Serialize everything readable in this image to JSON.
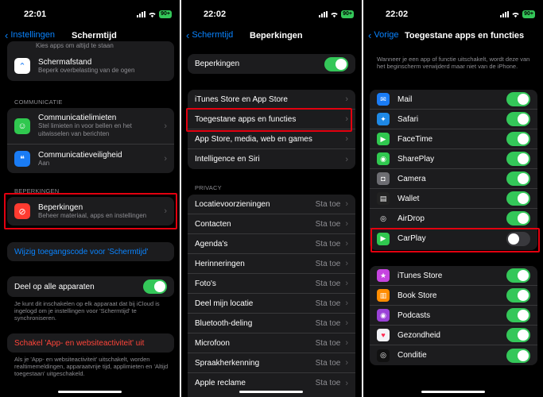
{
  "panel1": {
    "time": "22:01",
    "battery": "90+",
    "back_label": "Instellingen",
    "title": "Schermtijd",
    "top_item": {
      "partial_sub": "Kies apps om altijd te staan",
      "title": "Schermafstand",
      "sub": "Beperk overbelasting van de ogen"
    },
    "section_communicatie": "COMMUNICATIE",
    "comm_items": [
      {
        "title": "Communicatielimieten",
        "sub": "Stel limieten in voor bellen en het uitwisselen van berichten"
      },
      {
        "title": "Communicatieveiligheid",
        "sub": "Aan"
      }
    ],
    "section_beperkingen": "BEPERKINGEN",
    "beperkingen_item": {
      "title": "Beperkingen",
      "sub": "Beheer materiaal, apps en instellingen"
    },
    "passcode_link": "Wijzig toegangscode voor 'Schermtijd'",
    "share_label": "Deel op alle apparaten",
    "share_note": "Je kunt dit inschakelen op elk apparaat dat bij iCloud is ingelogd om je instellingen voor 'Schermtijd' te synchroniseren.",
    "disable_label": "Schakel 'App- en websiteactiviteit' uit",
    "disable_note": "Als je 'App- en websiteactiviteit' uitschakelt, worden realtimemeldingen, apparaatvrije tijd, applimieten en 'Altijd toegestaan' uitgeschakeld."
  },
  "panel2": {
    "time": "22:02",
    "battery": "90+",
    "back_label": "Schermtijd",
    "title": "Beperkingen",
    "toggle_label": "Beperkingen",
    "menu_items": [
      "iTunes Store en App Store",
      "Toegestane apps en functies",
      "App Store, media, web en games",
      "Intelligence en Siri"
    ],
    "privacy_header": "PRIVACY",
    "privacy_items": [
      {
        "label": "Locatievoorzieningen",
        "value": "Sta toe"
      },
      {
        "label": "Contacten",
        "value": "Sta toe"
      },
      {
        "label": "Agenda's",
        "value": "Sta toe"
      },
      {
        "label": "Herinneringen",
        "value": "Sta toe"
      },
      {
        "label": "Foto's",
        "value": "Sta toe"
      },
      {
        "label": "Deel mijn locatie",
        "value": "Sta toe"
      },
      {
        "label": "Bluetooth-deling",
        "value": "Sta toe"
      },
      {
        "label": "Microfoon",
        "value": "Sta toe"
      },
      {
        "label": "Spraakherkenning",
        "value": "Sta toe"
      },
      {
        "label": "Apple reclame",
        "value": "Sta toe"
      }
    ]
  },
  "panel3": {
    "time": "22:02",
    "battery": "90+",
    "back_label": "Vorige",
    "title": "Toegestane apps en functies",
    "note": "Wanneer je een app of functie uitschakelt, wordt deze van het beginscherm verwijderd maar niet van de iPhone.",
    "apps1": [
      {
        "label": "Mail",
        "on": true,
        "icon": "mail-icon",
        "color": "#1a7cf5",
        "glyph": "✉"
      },
      {
        "label": "Safari",
        "on": true,
        "icon": "safari-icon",
        "color": "#1e88e5",
        "glyph": "✦"
      },
      {
        "label": "FaceTime",
        "on": true,
        "icon": "facetime-icon",
        "color": "#30c84f",
        "glyph": "▶"
      },
      {
        "label": "SharePlay",
        "on": true,
        "icon": "shareplay-icon",
        "color": "#30c84f",
        "glyph": "◉"
      },
      {
        "label": "Camera",
        "on": true,
        "icon": "camera-icon",
        "color": "#6d6d72",
        "glyph": "◘"
      },
      {
        "label": "Wallet",
        "on": true,
        "icon": "wallet-icon",
        "color": "#222222",
        "glyph": "▤"
      },
      {
        "label": "AirDrop",
        "on": true,
        "icon": "airdrop-icon",
        "color": "#1c1c1e",
        "glyph": "◎"
      },
      {
        "label": "CarPlay",
        "on": false,
        "icon": "carplay-icon",
        "color": "#30c84f",
        "glyph": "▶"
      }
    ],
    "apps2": [
      {
        "label": "iTunes Store",
        "on": true,
        "icon": "itunes-star-icon",
        "color": "#c644e0",
        "glyph": "★"
      },
      {
        "label": "Book Store",
        "on": true,
        "icon": "book-icon",
        "color": "#ff8c00",
        "glyph": "▥"
      },
      {
        "label": "Podcasts",
        "on": true,
        "icon": "podcasts-icon",
        "color": "#9b42d8",
        "glyph": "◉"
      },
      {
        "label": "Gezondheid",
        "on": true,
        "icon": "health-heart-icon",
        "color": "#f2f2f7",
        "glyph": "♥"
      },
      {
        "label": "Conditie",
        "on": true,
        "icon": "fitness-rings-icon",
        "color": "#111111",
        "glyph": "◎"
      }
    ]
  }
}
